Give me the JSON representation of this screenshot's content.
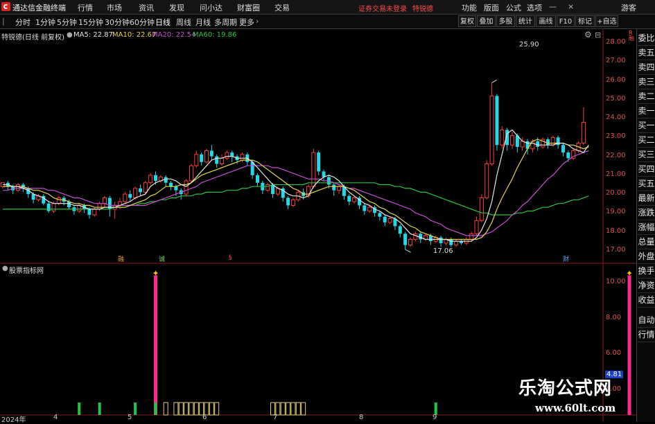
{
  "menubar": {
    "app_title": "通达信金融终端",
    "items": [
      "行情",
      "市场",
      "资讯",
      "发现",
      "问小达",
      "财富圈",
      "交易"
    ],
    "notice": "证券交易未登录",
    "special": "特锐德",
    "right_items": [
      "功能",
      "版面",
      "公式",
      "选项"
    ],
    "guest": "游客"
  },
  "toolbar": {
    "periods": [
      "分时",
      "1分钟",
      "5分钟",
      "15分钟",
      "30分钟",
      "60分钟",
      "日线",
      "周线",
      "月线",
      "多周期",
      "更多"
    ],
    "active": "日线",
    "right_buttons": [
      "复权",
      "叠加",
      "多股",
      "统计",
      "画线",
      "F10",
      "标记",
      "+自选"
    ]
  },
  "chart_header": {
    "stock": "特锐德(日线 前复权)",
    "ma5": "MA5: 22.87",
    "ma10": "MA10: 22.67",
    "ma20": "MA20: 22.54",
    "ma60": "MA60: 19.86"
  },
  "colors": {
    "up": "#ff3b3b",
    "down": "#26d7e8",
    "ma5": "#e8e8e8",
    "ma10": "#e5d84a",
    "ma20": "#c84dd6",
    "ma60": "#27c443",
    "signal": "#ff2a8c",
    "buy": "#25c447",
    "box": "#e8d27a"
  },
  "price_axis": [
    "28.00",
    "27.00",
    "26.00",
    "25.00",
    "24.00",
    "23.00",
    "22.00",
    "21.00",
    "20.00",
    "19.00",
    "18.00",
    "17.00"
  ],
  "annotations": {
    "high": "25.90",
    "low": "17.06"
  },
  "event_marks": [
    {
      "text": "融",
      "color": "#e6a23c"
    },
    {
      "text": "诚",
      "color": "#7bd36a"
    },
    {
      "text": "§",
      "color": "#ff4a4a"
    },
    {
      "text": "财",
      "color": "#6aa8ff"
    }
  ],
  "indicator": {
    "name": "股票指标网",
    "axis": [
      "10.00",
      "8.00",
      "6.00",
      "4.00"
    ],
    "current_value": "4.81"
  },
  "date_axis": [
    "2024年",
    "4",
    "5",
    "6",
    "7",
    "8",
    "9"
  ],
  "side_buttons": [
    "委比",
    "卖五",
    "卖四",
    "卖三",
    "卖二",
    "卖一",
    "买一",
    "买二",
    "买三",
    "买四",
    "买五",
    "最新",
    "涨跌",
    "涨幅",
    "总量",
    "外盘",
    "换手",
    "净资",
    "收益",
    "自动",
    "行情"
  ],
  "watermark": {
    "title": "乐淘公式网",
    "url": "www.60lt.com"
  },
  "chart_data": {
    "type": "candlestick",
    "ylim": [
      16.7,
      28.3
    ],
    "candles": [
      [
        20.4,
        20.6,
        20.3,
        20.5
      ],
      [
        20.6,
        20.4,
        20.2,
        20.7
      ],
      [
        20.4,
        20.2,
        20.0,
        20.5
      ],
      [
        20.2,
        20.5,
        20.1,
        20.6
      ],
      [
        20.5,
        20.3,
        20.1,
        20.6
      ],
      [
        20.3,
        20.0,
        19.8,
        20.4
      ],
      [
        20.0,
        19.7,
        19.5,
        20.1
      ],
      [
        19.7,
        19.9,
        19.6,
        20.0
      ],
      [
        19.9,
        19.5,
        19.4,
        20.0
      ],
      [
        19.5,
        19.1,
        19.0,
        19.6
      ],
      [
        19.1,
        19.5,
        19.0,
        19.6
      ],
      [
        19.5,
        19.8,
        19.4,
        19.9
      ],
      [
        19.8,
        19.6,
        19.4,
        19.9
      ],
      [
        19.6,
        19.3,
        19.2,
        19.7
      ],
      [
        19.3,
        19.1,
        18.9,
        19.4
      ],
      [
        19.1,
        19.4,
        19.0,
        19.5
      ],
      [
        19.4,
        19.2,
        19.0,
        19.5
      ],
      [
        19.2,
        18.9,
        18.7,
        19.3
      ],
      [
        18.9,
        19.2,
        18.8,
        19.3
      ],
      [
        19.2,
        19.5,
        19.1,
        19.6
      ],
      [
        19.5,
        19.8,
        19.3,
        19.9
      ],
      [
        19.8,
        19.2,
        18.8,
        19.9
      ],
      [
        19.2,
        19.4,
        18.7,
        19.6
      ],
      [
        19.4,
        19.6,
        19.2,
        19.8
      ],
      [
        19.6,
        20.0,
        19.5,
        20.1
      ],
      [
        20.0,
        19.8,
        19.6,
        20.2
      ],
      [
        19.8,
        20.3,
        19.7,
        20.4
      ],
      [
        20.3,
        20.1,
        19.9,
        20.5
      ],
      [
        20.1,
        20.6,
        20.0,
        20.7
      ],
      [
        20.6,
        21.0,
        20.5,
        21.1
      ],
      [
        21.0,
        20.7,
        20.5,
        21.2
      ],
      [
        20.7,
        20.9,
        20.6,
        21.0
      ],
      [
        20.9,
        20.6,
        20.4,
        21.0
      ],
      [
        20.6,
        20.4,
        20.2,
        20.7
      ],
      [
        20.4,
        20.2,
        19.9,
        20.5
      ],
      [
        20.2,
        20.0,
        19.7,
        20.3
      ],
      [
        20.0,
        20.7,
        19.9,
        20.8
      ],
      [
        20.7,
        21.5,
        20.6,
        21.6
      ],
      [
        21.5,
        22.1,
        21.4,
        22.3
      ],
      [
        22.1,
        21.7,
        21.5,
        22.2
      ],
      [
        21.7,
        22.3,
        21.6,
        22.4
      ],
      [
        22.3,
        22.0,
        21.8,
        22.6
      ],
      [
        22.0,
        21.6,
        21.4,
        22.1
      ],
      [
        21.6,
        21.9,
        21.5,
        22.1
      ],
      [
        21.9,
        22.2,
        21.8,
        22.3
      ],
      [
        22.2,
        22.0,
        21.7,
        22.3
      ],
      [
        22.0,
        21.8,
        21.6,
        22.1
      ],
      [
        21.8,
        22.1,
        21.7,
        22.2
      ],
      [
        22.1,
        21.7,
        21.5,
        22.2
      ],
      [
        21.7,
        21.0,
        20.8,
        21.8
      ],
      [
        21.0,
        20.6,
        20.4,
        21.1
      ],
      [
        20.6,
        20.2,
        20.0,
        20.7
      ],
      [
        20.2,
        20.5,
        20.1,
        20.6
      ],
      [
        20.5,
        20.0,
        19.8,
        20.6
      ],
      [
        20.0,
        20.3,
        19.9,
        20.4
      ],
      [
        20.3,
        19.8,
        19.6,
        20.4
      ],
      [
        19.8,
        19.4,
        19.2,
        19.9
      ],
      [
        19.4,
        19.7,
        19.3,
        19.8
      ],
      [
        19.7,
        20.1,
        19.6,
        20.2
      ],
      [
        20.1,
        19.9,
        19.7,
        20.3
      ],
      [
        19.9,
        20.4,
        19.8,
        20.5
      ],
      [
        20.4,
        22.2,
        20.3,
        22.4
      ],
      [
        22.2,
        21.2,
        21.0,
        22.3
      ],
      [
        21.2,
        20.9,
        20.7,
        21.3
      ],
      [
        20.9,
        20.5,
        20.3,
        21.0
      ],
      [
        20.5,
        20.2,
        19.9,
        20.6
      ],
      [
        20.2,
        20.4,
        20.0,
        20.5
      ],
      [
        20.4,
        19.9,
        19.7,
        20.5
      ],
      [
        19.9,
        19.6,
        19.4,
        20.0
      ],
      [
        19.6,
        19.8,
        19.5,
        19.9
      ],
      [
        19.8,
        19.4,
        19.2,
        19.9
      ],
      [
        19.4,
        19.1,
        18.9,
        19.5
      ],
      [
        19.1,
        19.3,
        19.0,
        19.4
      ],
      [
        19.3,
        19.0,
        18.8,
        19.4
      ],
      [
        19.0,
        18.8,
        18.6,
        19.1
      ],
      [
        18.8,
        18.5,
        18.3,
        18.9
      ],
      [
        18.5,
        18.7,
        18.4,
        18.8
      ],
      [
        18.7,
        18.3,
        18.1,
        18.8
      ],
      [
        18.3,
        17.9,
        17.7,
        18.4
      ],
      [
        17.9,
        17.3,
        17.06,
        18.0
      ],
      [
        17.3,
        17.6,
        17.2,
        17.7
      ],
      [
        17.6,
        17.9,
        17.5,
        18.0
      ],
      [
        17.9,
        17.6,
        17.4,
        18.0
      ],
      [
        17.6,
        17.8,
        17.5,
        17.9
      ],
      [
        17.8,
        17.5,
        17.3,
        17.9
      ],
      [
        17.5,
        17.7,
        17.4,
        17.8
      ],
      [
        17.7,
        17.4,
        17.2,
        17.8
      ],
      [
        17.4,
        17.6,
        17.3,
        17.7
      ],
      [
        17.6,
        17.3,
        17.2,
        17.7
      ],
      [
        17.3,
        17.5,
        17.2,
        17.6
      ],
      [
        17.5,
        17.4,
        17.3,
        17.6
      ],
      [
        17.4,
        17.6,
        17.3,
        17.7
      ],
      [
        17.6,
        17.9,
        17.5,
        18.0
      ],
      [
        17.9,
        18.6,
        17.8,
        18.8
      ],
      [
        18.6,
        19.8,
        18.5,
        20.0
      ],
      [
        19.8,
        21.6,
        19.7,
        21.8
      ],
      [
        21.6,
        25.2,
        21.5,
        25.9
      ],
      [
        25.2,
        22.6,
        22.3,
        25.3
      ],
      [
        22.6,
        23.4,
        22.4,
        23.6
      ],
      [
        23.4,
        22.6,
        22.3,
        23.5
      ],
      [
        22.6,
        23.1,
        22.4,
        23.3
      ],
      [
        23.1,
        22.5,
        22.2,
        23.2
      ],
      [
        22.5,
        22.8,
        22.3,
        23.0
      ],
      [
        22.8,
        22.4,
        22.1,
        22.9
      ],
      [
        22.4,
        22.8,
        22.2,
        22.9
      ],
      [
        22.8,
        22.5,
        22.3,
        23.0
      ],
      [
        22.5,
        22.9,
        22.4,
        23.0
      ],
      [
        22.9,
        22.6,
        22.4,
        23.0
      ],
      [
        22.6,
        23.0,
        22.5,
        23.1
      ],
      [
        23.0,
        22.6,
        22.4,
        23.1
      ],
      [
        22.6,
        22.2,
        22.0,
        22.7
      ],
      [
        22.2,
        21.9,
        21.7,
        22.3
      ],
      [
        21.9,
        22.3,
        21.8,
        22.4
      ],
      [
        22.3,
        22.7,
        22.2,
        22.8
      ],
      [
        22.7,
        23.8,
        22.6,
        24.6
      ]
    ],
    "ma5": [
      20.5,
      20.5,
      20.4,
      20.4,
      20.3,
      20.2,
      20.0,
      19.9,
      19.8,
      19.6,
      19.5,
      19.5,
      19.5,
      19.5,
      19.4,
      19.4,
      19.3,
      19.2,
      19.2,
      19.2,
      19.3,
      19.3,
      19.3,
      19.4,
      19.5,
      19.6,
      19.8,
      19.9,
      20.0,
      20.4,
      20.6,
      20.7,
      20.8,
      20.8,
      20.7,
      20.5,
      20.4,
      20.6,
      20.9,
      21.2,
      21.5,
      21.8,
      21.9,
      21.9,
      22.0,
      22.0,
      21.9,
      21.9,
      21.9,
      21.7,
      21.4,
      21.1,
      20.8,
      20.5,
      20.3,
      20.2,
      20.0,
      19.9,
      19.9,
      19.8,
      19.9,
      20.4,
      20.7,
      20.9,
      21.0,
      20.9,
      20.7,
      20.4,
      20.1,
      19.9,
      19.7,
      19.5,
      19.4,
      19.2,
      19.1,
      18.9,
      18.8,
      18.7,
      18.5,
      18.2,
      17.9,
      17.8,
      17.7,
      17.6,
      17.6,
      17.6,
      17.6,
      17.6,
      17.5,
      17.5,
      17.5,
      17.5,
      17.5,
      17.7,
      18.1,
      18.7,
      19.6,
      21.0,
      22.1,
      23.2,
      23.4,
      23.1,
      22.8,
      22.7,
      22.7,
      22.6,
      22.6,
      22.6,
      22.6,
      22.7,
      22.7,
      22.6,
      22.4,
      22.3,
      22.2,
      22.6
    ],
    "ma10": [
      20.4,
      20.4,
      20.4,
      20.4,
      20.4,
      20.3,
      20.2,
      20.2,
      20.1,
      20.0,
      19.8,
      19.7,
      19.7,
      19.6,
      19.5,
      19.5,
      19.4,
      19.4,
      19.3,
      19.3,
      19.3,
      19.3,
      19.3,
      19.3,
      19.3,
      19.4,
      19.5,
      19.6,
      19.7,
      19.9,
      20.0,
      20.2,
      20.4,
      20.4,
      20.4,
      20.5,
      20.5,
      20.6,
      20.8,
      21.0,
      21.1,
      21.2,
      21.3,
      21.4,
      21.5,
      21.6,
      21.7,
      21.8,
      21.8,
      21.8,
      21.7,
      21.5,
      21.3,
      21.1,
      20.9,
      20.7,
      20.5,
      20.3,
      20.2,
      20.0,
      20.0,
      20.1,
      20.2,
      20.3,
      20.4,
      20.4,
      20.4,
      20.4,
      20.3,
      20.2,
      20.0,
      19.8,
      19.6,
      19.5,
      19.3,
      19.2,
      19.0,
      18.9,
      18.7,
      18.5,
      18.3,
      18.2,
      18.0,
      17.9,
      17.8,
      17.7,
      17.6,
      17.6,
      17.6,
      17.6,
      17.6,
      17.6,
      17.6,
      17.6,
      17.7,
      18.0,
      18.5,
      19.2,
      19.8,
      20.3,
      20.8,
      21.4,
      21.9,
      22.4,
      22.8,
      22.9,
      22.8,
      22.7,
      22.7,
      22.7,
      22.7,
      22.6,
      22.6,
      22.5,
      22.4,
      22.5
    ],
    "ma20": [
      20.2,
      20.2,
      20.3,
      20.3,
      20.3,
      20.3,
      20.3,
      20.3,
      20.3,
      20.2,
      20.2,
      20.1,
      20.0,
      19.9,
      19.8,
      19.8,
      19.7,
      19.6,
      19.5,
      19.5,
      19.5,
      19.4,
      19.4,
      19.4,
      19.4,
      19.4,
      19.4,
      19.4,
      19.4,
      19.5,
      19.6,
      19.7,
      19.8,
      19.9,
      20.0,
      20.1,
      20.2,
      20.3,
      20.4,
      20.6,
      20.7,
      20.8,
      20.9,
      21.0,
      21.1,
      21.2,
      21.3,
      21.4,
      21.5,
      21.5,
      21.5,
      21.5,
      21.5,
      21.4,
      21.4,
      21.3,
      21.2,
      21.1,
      21.0,
      20.9,
      20.8,
      20.8,
      20.8,
      20.7,
      20.7,
      20.6,
      20.5,
      20.4,
      20.3,
      20.3,
      20.2,
      20.1,
      20.0,
      19.9,
      19.8,
      19.7,
      19.6,
      19.5,
      19.4,
      19.3,
      19.2,
      19.0,
      18.9,
      18.8,
      18.6,
      18.5,
      18.4,
      18.2,
      18.1,
      18.0,
      17.9,
      17.8,
      17.8,
      17.8,
      17.8,
      17.9,
      18.0,
      18.2,
      18.4,
      18.6,
      18.9,
      19.1,
      19.4,
      19.6,
      19.9,
      20.2,
      20.5,
      20.8,
      21.0,
      21.3,
      21.6,
      21.8,
      22.0,
      22.1,
      22.2,
      22.3
    ],
    "ma60": [
      19.2,
      19.2,
      19.2,
      19.2,
      19.2,
      19.2,
      19.2,
      19.2,
      19.2,
      19.2,
      19.2,
      19.2,
      19.2,
      19.2,
      19.2,
      19.2,
      19.2,
      19.2,
      19.2,
      19.2,
      19.2,
      19.2,
      19.3,
      19.3,
      19.3,
      19.4,
      19.4,
      19.5,
      19.5,
      19.6,
      19.6,
      19.7,
      19.7,
      19.8,
      19.8,
      19.9,
      19.9,
      19.9,
      20.0,
      20.0,
      20.1,
      20.1,
      20.1,
      20.1,
      20.2,
      20.2,
      20.2,
      20.3,
      20.3,
      20.4,
      20.4,
      20.4,
      20.4,
      20.5,
      20.5,
      20.5,
      20.5,
      20.5,
      20.5,
      20.5,
      20.6,
      20.6,
      20.6,
      20.6,
      20.6,
      20.6,
      20.6,
      20.6,
      20.6,
      20.6,
      20.6,
      20.6,
      20.6,
      20.6,
      20.5,
      20.5,
      20.5,
      20.4,
      20.4,
      20.3,
      20.3,
      20.2,
      20.1,
      20.1,
      20.0,
      19.9,
      19.8,
      19.7,
      19.6,
      19.5,
      19.4,
      19.3,
      19.2,
      19.1,
      19.0,
      19.0,
      18.9,
      18.9,
      18.9,
      18.9,
      18.9,
      19.0,
      19.0,
      19.1,
      19.1,
      19.2,
      19.3,
      19.3,
      19.4,
      19.5,
      19.5,
      19.6,
      19.7,
      19.7,
      19.8,
      19.9
    ],
    "indicator_ylim": [
      2.6,
      11.0
    ],
    "signal_days": [
      30,
      123
    ],
    "buy_days": [
      15,
      19,
      26,
      30,
      85
    ],
    "box_days": [
      32,
      34,
      35,
      36,
      37,
      38,
      39,
      40,
      41,
      42,
      53,
      54,
      55,
      56,
      57,
      58,
      59
    ]
  }
}
